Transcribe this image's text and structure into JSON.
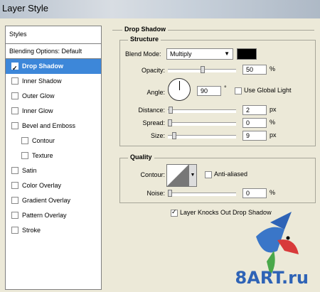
{
  "window": {
    "title": "Layer Style"
  },
  "left_panel": {
    "styles_label": "Styles",
    "blending_label": "Blending Options: Default",
    "items": [
      {
        "label": "Drop Shadow",
        "checked": true,
        "selected": true
      },
      {
        "label": "Inner Shadow",
        "checked": false
      },
      {
        "label": "Outer Glow",
        "checked": false
      },
      {
        "label": "Inner Glow",
        "checked": false
      },
      {
        "label": "Bevel and Emboss",
        "checked": false
      },
      {
        "label": "Contour",
        "checked": false,
        "sub": true
      },
      {
        "label": "Texture",
        "checked": false,
        "sub": true
      },
      {
        "label": "Satin",
        "checked": false
      },
      {
        "label": "Color Overlay",
        "checked": false
      },
      {
        "label": "Gradient Overlay",
        "checked": false
      },
      {
        "label": "Pattern Overlay",
        "checked": false
      },
      {
        "label": "Stroke",
        "checked": false
      }
    ]
  },
  "drop_shadow": {
    "title": "Drop Shadow",
    "structure": {
      "title": "Structure",
      "blend_mode_label": "Blend Mode:",
      "blend_mode_value": "Multiply",
      "shadow_color": "#000000",
      "opacity_label": "Opacity:",
      "opacity_value": "50",
      "opacity_unit": "%",
      "angle_label": "Angle:",
      "angle_value": "90",
      "angle_unit": "°",
      "use_global_light_label": "Use Global Light",
      "distance_label": "Distance:",
      "distance_value": "2",
      "distance_unit": "px",
      "spread_label": "Spread:",
      "spread_value": "0",
      "spread_unit": "%",
      "size_label": "Size:",
      "size_value": "9",
      "size_unit": "px"
    },
    "quality": {
      "title": "Quality",
      "contour_label": "Contour:",
      "anti_aliased_label": "Anti-aliased",
      "noise_label": "Noise:",
      "noise_value": "0",
      "noise_unit": "%"
    },
    "knockout_label": "Layer Knocks Out Drop Shadow"
  },
  "watermark": {
    "text": "8ART.ru"
  }
}
